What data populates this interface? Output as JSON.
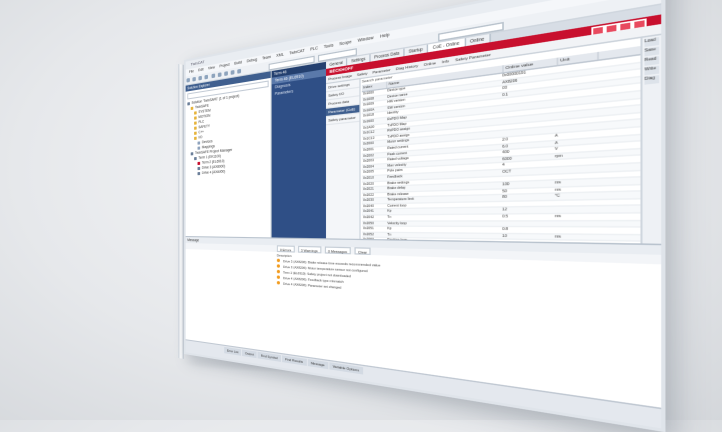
{
  "window": {
    "title": "TwinCAT"
  },
  "menu": [
    "File",
    "Edit",
    "View",
    "Project",
    "Build",
    "Debug",
    "Team",
    "XML",
    "TwinCAT",
    "PLC",
    "Tools",
    "Scope",
    "Window",
    "Help"
  ],
  "solution_explorer": {
    "header": "Solution Explorer",
    "items": [
      {
        "label": "Solution 'TwinSAFE' (1 of 1 project)",
        "color": "#6b7f99",
        "indent": 0
      },
      {
        "label": "TwinSAFE",
        "color": "#e6b33a",
        "indent": 1
      },
      {
        "label": "SYSTEM",
        "color": "#e6b33a",
        "indent": 2
      },
      {
        "label": "MOTION",
        "color": "#e6b33a",
        "indent": 2
      },
      {
        "label": "PLC",
        "color": "#e6b33a",
        "indent": 2
      },
      {
        "label": "SAFETY",
        "color": "#e6b33a",
        "indent": 2
      },
      {
        "label": "C++",
        "color": "#e6b33a",
        "indent": 2
      },
      {
        "label": "I/O",
        "color": "#e6b33a",
        "indent": 2
      },
      {
        "label": "Devices",
        "color": "#8fa3bd",
        "indent": 3
      },
      {
        "label": "Mappings",
        "color": "#8fa3bd",
        "indent": 3
      },
      {
        "label": "TwinSAFE Project Manager",
        "color": "#6b7f99",
        "indent": 1
      },
      {
        "label": "Term 1 (EK1100)",
        "color": "#6b7f99",
        "indent": 2
      },
      {
        "label": "Term 2 (EL6910)",
        "color": "#c8102e",
        "indent": 3
      },
      {
        "label": "Drive 3 (AX8000)",
        "color": "#6b7f99",
        "indent": 3
      },
      {
        "label": "Drive 4 (AX8000)",
        "color": "#6b7f99",
        "indent": 3
      }
    ]
  },
  "nav_panel": {
    "header": "Term 46",
    "items": [
      {
        "label": "Term 46 (EL6910)",
        "selected": true
      },
      {
        "label": "Diagnosis",
        "selected": false
      },
      {
        "label": "Parameters",
        "selected": false
      }
    ]
  },
  "main": {
    "tabs": [
      "General",
      "Settings",
      "Process Data",
      "Startup",
      "CoE - Online",
      "Online"
    ],
    "brand": "BECKHOFF",
    "subtabs": [
      "Process Image",
      "Safety",
      "Parameter",
      "Diag History",
      "Online",
      "Info",
      "Safety Parameter"
    ],
    "left_list": [
      {
        "label": "Drive settings",
        "selected": false
      },
      {
        "label": "Safety I/O",
        "selected": false
      },
      {
        "label": "Process data",
        "selected": false
      },
      {
        "label": "Parameter (CoE)",
        "selected": true
      },
      {
        "label": "Safety parameter",
        "selected": false
      }
    ],
    "search_label": "Search parameter",
    "columns": [
      "Index",
      "Name",
      "Online value",
      "Unit"
    ],
    "rows": [
      {
        "index": "0x1000",
        "name": "Device type",
        "value": "0x00000191",
        "unit": ""
      },
      {
        "index": "0x1008",
        "name": "Device name",
        "value": "AX8206",
        "unit": ""
      },
      {
        "index": "0x1009",
        "name": "HW version",
        "value": "03",
        "unit": ""
      },
      {
        "index": "0x100A",
        "name": "SW version",
        "value": "0.1",
        "unit": ""
      },
      {
        "index": "0x1018",
        "name": "Identity",
        "value": "",
        "unit": ""
      },
      {
        "index": "0x1600",
        "name": "RxPDO Map",
        "value": "",
        "unit": ""
      },
      {
        "index": "0x1A00",
        "name": "TxPDO Map",
        "value": "",
        "unit": ""
      },
      {
        "index": "0x1C12",
        "name": "RxPDO assign",
        "value": "",
        "unit": ""
      },
      {
        "index": "0x1C13",
        "name": "TxPDO assign",
        "value": "",
        "unit": ""
      },
      {
        "index": "0x2000",
        "name": "Motor settings",
        "value": "",
        "unit": ""
      },
      {
        "index": "0x2001",
        "name": "Rated current",
        "value": "2.0",
        "unit": "A"
      },
      {
        "index": "0x2002",
        "name": "Peak current",
        "value": "6.0",
        "unit": "A"
      },
      {
        "index": "0x2003",
        "name": "Rated voltage",
        "value": "400",
        "unit": "V"
      },
      {
        "index": "0x2004",
        "name": "Max velocity",
        "value": "6000",
        "unit": "rpm"
      },
      {
        "index": "0x2005",
        "name": "Pole pairs",
        "value": "4",
        "unit": ""
      },
      {
        "index": "0x2010",
        "name": "Feedback",
        "value": "OCT",
        "unit": ""
      },
      {
        "index": "0x2020",
        "name": "Brake settings",
        "value": "",
        "unit": ""
      },
      {
        "index": "0x2021",
        "name": "Brake delay",
        "value": "100",
        "unit": "ms"
      },
      {
        "index": "0x2022",
        "name": "Brake release",
        "value": "50",
        "unit": "ms"
      },
      {
        "index": "0x2030",
        "name": "Temperature limit",
        "value": "80",
        "unit": "°C"
      },
      {
        "index": "0x2040",
        "name": "Current loop",
        "value": "",
        "unit": ""
      },
      {
        "index": "0x2041",
        "name": "Kp",
        "value": "12",
        "unit": ""
      },
      {
        "index": "0x2042",
        "name": "Tn",
        "value": "0.5",
        "unit": "ms"
      },
      {
        "index": "0x2050",
        "name": "Velocity loop",
        "value": "",
        "unit": ""
      },
      {
        "index": "0x2051",
        "name": "Kp",
        "value": "0.8",
        "unit": ""
      },
      {
        "index": "0x2052",
        "name": "Tn",
        "value": "10",
        "unit": "ms"
      },
      {
        "index": "0x2060",
        "name": "Position loop",
        "value": "",
        "unit": ""
      },
      {
        "index": "0x2061",
        "name": "Kv",
        "value": "1",
        "unit": ""
      }
    ],
    "right_strip": [
      "Load",
      "Save",
      "Read",
      "Write",
      "Diag"
    ]
  },
  "messages": {
    "header": "Message",
    "toolbar": [
      "0 Errors",
      "3 Warnings",
      "0 Messages",
      "Clear"
    ],
    "rows": [
      "Description",
      "Drive 3 (AX8206): Brake release time exceeds recommended value",
      "Drive 3 (AX8206): Motor temperature sensor not configured",
      "Term 2 (EL6910): Safety project not downloaded",
      "Drive 4 (AX8206): Feedback type mismatch",
      "Drive 4 (AX8206): Parameter set changed"
    ]
  },
  "statusbar": [
    "Error List",
    "Output",
    "Find Symbol",
    "Find Results",
    "Message",
    "Variable Options"
  ]
}
